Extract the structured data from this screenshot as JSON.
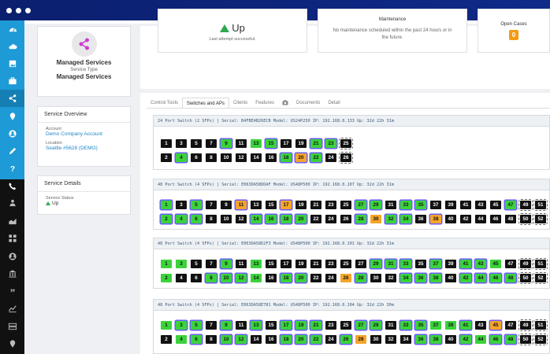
{
  "sidebar": {
    "items": [
      {
        "icon": "dashboard-icon",
        "active": false
      },
      {
        "icon": "cloud-icon",
        "active": false
      },
      {
        "icon": "image-icon",
        "active": false
      },
      {
        "icon": "briefcase-icon",
        "active": false
      },
      {
        "icon": "share-icon",
        "active": true
      },
      {
        "icon": "map-pin-icon",
        "active": false
      },
      {
        "icon": "user-circle-icon",
        "active": false
      },
      {
        "icon": "pencil-icon",
        "active": false
      },
      {
        "icon": "question-icon",
        "active": false
      },
      {
        "icon": "phone-icon",
        "active": false
      },
      {
        "icon": "users-icon",
        "active": false
      },
      {
        "icon": "area-chart-icon",
        "active": false
      },
      {
        "icon": "grid-icon",
        "active": false
      },
      {
        "icon": "dark-user-icon",
        "active": false
      },
      {
        "icon": "bank-icon",
        "active": false
      },
      {
        "icon": "quote-icon",
        "active": false
      },
      {
        "icon": "line-chart-icon",
        "active": false
      },
      {
        "icon": "server-icon",
        "active": false
      },
      {
        "icon": "location-icon",
        "active": false
      }
    ]
  },
  "service": {
    "name": "Managed Services",
    "type_label": "Service Type",
    "type": "Managed Services"
  },
  "overview": {
    "title": "Service Overview",
    "account_label": "Account",
    "account": "Demo Company Account",
    "location_label": "Location",
    "location": "Seattle #5628 (DEMO)"
  },
  "details": {
    "title": "Service Details",
    "status_label": "Service Status",
    "status": "Up"
  },
  "status": {
    "state": "Up",
    "sub": "Last attempt successful.",
    "maint_title": "Maintenance",
    "maint_text": "No maintenance scheduled within the past 24 hours or in the future.",
    "cases_title": "Open Cases",
    "cases_count": "0"
  },
  "tabs": [
    "Control Tools",
    "Switches and APs",
    "Clients",
    "Features",
    "",
    "Documents",
    "Detail"
  ],
  "active_tab": 1,
  "switches": [
    {
      "header": "24 Port Switch (2 SFPs) | Serial: B4FBE4B26ECB Model: US24P250 IP: 192.168.0.133 Up: 32d 22h 31m",
      "top": [
        {
          "n": "1",
          "c": "b"
        },
        {
          "n": "3",
          "c": "b"
        },
        {
          "n": "5",
          "c": "b"
        },
        {
          "n": "7",
          "c": "b"
        },
        {
          "n": "9",
          "c": "g",
          "r": 1
        },
        {
          "n": "11",
          "c": "b"
        },
        {
          "n": "13",
          "c": "g"
        },
        {
          "n": "15",
          "c": "g",
          "r": 1
        },
        {
          "n": "17",
          "c": "b"
        },
        {
          "n": "19",
          "c": "b"
        },
        {
          "n": "21",
          "c": "g",
          "r": 1
        },
        {
          "n": "23",
          "c": "g",
          "r": 1
        },
        {
          "n": "25",
          "c": "b",
          "s": 1
        }
      ],
      "bottom": [
        {
          "n": "2",
          "c": "b"
        },
        {
          "n": "4",
          "c": "g",
          "r": 1
        },
        {
          "n": "6",
          "c": "b"
        },
        {
          "n": "8",
          "c": "b"
        },
        {
          "n": "10",
          "c": "b"
        },
        {
          "n": "12",
          "c": "b"
        },
        {
          "n": "14",
          "c": "b"
        },
        {
          "n": "16",
          "c": "b"
        },
        {
          "n": "18",
          "c": "g",
          "r": 1
        },
        {
          "n": "20",
          "c": "o",
          "r": 1
        },
        {
          "n": "22",
          "c": "g",
          "r": 1
        },
        {
          "n": "24",
          "c": "b"
        },
        {
          "n": "26",
          "c": "b",
          "s": 1
        }
      ]
    },
    {
      "header": "48 Port Switch (4 SFPs) | Serial: E063DA58DDAF Model: US48P500 IP: 192.168.0.107 Up: 32d 22h 31m",
      "top": [
        {
          "n": "1",
          "c": "g",
          "r": 1
        },
        {
          "n": "3",
          "c": "b"
        },
        {
          "n": "5",
          "c": "g",
          "r": 1
        },
        {
          "n": "7",
          "c": "b"
        },
        {
          "n": "9",
          "c": "b"
        },
        {
          "n": "11",
          "c": "o",
          "r": 1
        },
        {
          "n": "13",
          "c": "b"
        },
        {
          "n": "15",
          "c": "b"
        },
        {
          "n": "17",
          "c": "o",
          "r": 1
        },
        {
          "n": "19",
          "c": "b"
        },
        {
          "n": "21",
          "c": "b"
        },
        {
          "n": "23",
          "c": "b"
        },
        {
          "n": "25",
          "c": "b"
        },
        {
          "n": "27",
          "c": "g",
          "r": 1
        },
        {
          "n": "29",
          "c": "g",
          "r": 1
        },
        {
          "n": "31",
          "c": "b"
        },
        {
          "n": "33",
          "c": "g",
          "r": 1
        },
        {
          "n": "35",
          "c": "g",
          "r": 1
        },
        {
          "n": "37",
          "c": "b"
        },
        {
          "n": "39",
          "c": "b"
        },
        {
          "n": "41",
          "c": "b"
        },
        {
          "n": "43",
          "c": "b"
        },
        {
          "n": "45",
          "c": "b"
        },
        {
          "n": "47",
          "c": "g",
          "r": 1
        },
        {
          "n": "49",
          "c": "b",
          "s": 1
        },
        {
          "n": "51",
          "c": "b",
          "s": 1
        }
      ],
      "bottom": [
        {
          "n": "2",
          "c": "g",
          "r": 1
        },
        {
          "n": "4",
          "c": "g",
          "r": 1
        },
        {
          "n": "6",
          "c": "g",
          "r": 1
        },
        {
          "n": "8",
          "c": "b"
        },
        {
          "n": "10",
          "c": "b"
        },
        {
          "n": "12",
          "c": "b"
        },
        {
          "n": "14",
          "c": "g",
          "r": 1
        },
        {
          "n": "16",
          "c": "g",
          "r": 1
        },
        {
          "n": "18",
          "c": "g",
          "r": 1
        },
        {
          "n": "20",
          "c": "g",
          "r": 1
        },
        {
          "n": "22",
          "c": "b"
        },
        {
          "n": "24",
          "c": "b"
        },
        {
          "n": "26",
          "c": "b"
        },
        {
          "n": "28",
          "c": "g",
          "r": 1
        },
        {
          "n": "30",
          "c": "o"
        },
        {
          "n": "32",
          "c": "g",
          "r": 1
        },
        {
          "n": "34",
          "c": "g",
          "r": 1
        },
        {
          "n": "36",
          "c": "b"
        },
        {
          "n": "38",
          "c": "o",
          "r": 1
        },
        {
          "n": "40",
          "c": "b"
        },
        {
          "n": "42",
          "c": "b"
        },
        {
          "n": "44",
          "c": "b"
        },
        {
          "n": "46",
          "c": "b"
        },
        {
          "n": "48",
          "c": "b"
        },
        {
          "n": "50",
          "c": "b",
          "s": 1
        },
        {
          "n": "52",
          "c": "b",
          "s": 1
        }
      ]
    },
    {
      "header": "48 Port Switch (4 SFPs) | Serial: E063DA58D2F3 Model: US48P500 IP: 192.168.0.101 Up: 32d 22h 31m",
      "top": [
        {
          "n": "1",
          "c": "g"
        },
        {
          "n": "3",
          "c": "g"
        },
        {
          "n": "5",
          "c": "b"
        },
        {
          "n": "7",
          "c": "b"
        },
        {
          "n": "9",
          "c": "g",
          "r": 1
        },
        {
          "n": "11",
          "c": "b"
        },
        {
          "n": "13",
          "c": "g"
        },
        {
          "n": "15",
          "c": "b"
        },
        {
          "n": "17",
          "c": "b"
        },
        {
          "n": "19",
          "c": "b"
        },
        {
          "n": "21",
          "c": "b"
        },
        {
          "n": "23",
          "c": "b"
        },
        {
          "n": "25",
          "c": "b"
        },
        {
          "n": "27",
          "c": "b"
        },
        {
          "n": "29",
          "c": "g",
          "r": 1
        },
        {
          "n": "31",
          "c": "g",
          "r": 1
        },
        {
          "n": "33",
          "c": "g",
          "r": 1
        },
        {
          "n": "35",
          "c": "b"
        },
        {
          "n": "37",
          "c": "g",
          "r": 1
        },
        {
          "n": "39",
          "c": "b"
        },
        {
          "n": "41",
          "c": "g",
          "r": 1
        },
        {
          "n": "43",
          "c": "g",
          "r": 1
        },
        {
          "n": "45",
          "c": "g"
        },
        {
          "n": "47",
          "c": "b"
        },
        {
          "n": "49",
          "c": "b",
          "s": 1
        },
        {
          "n": "51",
          "c": "b",
          "s": 1
        }
      ],
      "bottom": [
        {
          "n": "2",
          "c": "g"
        },
        {
          "n": "4",
          "c": "b"
        },
        {
          "n": "6",
          "c": "b"
        },
        {
          "n": "8",
          "c": "g",
          "r": 1
        },
        {
          "n": "10",
          "c": "g",
          "r": 1
        },
        {
          "n": "12",
          "c": "g",
          "r": 1
        },
        {
          "n": "14",
          "c": "g"
        },
        {
          "n": "16",
          "c": "b"
        },
        {
          "n": "18",
          "c": "g",
          "r": 1
        },
        {
          "n": "20",
          "c": "g",
          "r": 1
        },
        {
          "n": "22",
          "c": "b"
        },
        {
          "n": "24",
          "c": "b"
        },
        {
          "n": "26",
          "c": "o"
        },
        {
          "n": "28",
          "c": "g",
          "r": 1
        },
        {
          "n": "30",
          "c": "b"
        },
        {
          "n": "32",
          "c": "b"
        },
        {
          "n": "34",
          "c": "g",
          "r": 1
        },
        {
          "n": "36",
          "c": "g",
          "r": 1
        },
        {
          "n": "38",
          "c": "g",
          "r": 1
        },
        {
          "n": "40",
          "c": "b"
        },
        {
          "n": "42",
          "c": "g",
          "r": 1
        },
        {
          "n": "44",
          "c": "g",
          "r": 1
        },
        {
          "n": "46",
          "c": "g",
          "r": 1
        },
        {
          "n": "48",
          "c": "g",
          "r": 1
        },
        {
          "n": "50",
          "c": "b",
          "s": 1
        },
        {
          "n": "52",
          "c": "b",
          "s": 1
        }
      ]
    },
    {
      "header": "48 Port Switch (4 SFPs) | Serial: E063DA58E781 Model: US48P500 IP: 192.168.0.104 Up: 32d 22h 30m",
      "top": [
        {
          "n": "1",
          "c": "g"
        },
        {
          "n": "3",
          "c": "g",
          "r": 1
        },
        {
          "n": "5",
          "c": "g",
          "r": 1
        },
        {
          "n": "7",
          "c": "b"
        },
        {
          "n": "9",
          "c": "g",
          "r": 1
        },
        {
          "n": "11",
          "c": "b"
        },
        {
          "n": "13",
          "c": "g",
          "r": 1
        },
        {
          "n": "15",
          "c": "b"
        },
        {
          "n": "17",
          "c": "g",
          "r": 1
        },
        {
          "n": "19",
          "c": "g",
          "r": 1
        },
        {
          "n": "21",
          "c": "g",
          "r": 1
        },
        {
          "n": "23",
          "c": "b"
        },
        {
          "n": "25",
          "c": "b"
        },
        {
          "n": "27",
          "c": "g",
          "r": 1
        },
        {
          "n": "29",
          "c": "g",
          "r": 1
        },
        {
          "n": "31",
          "c": "b"
        },
        {
          "n": "33",
          "c": "g",
          "r": 1
        },
        {
          "n": "35",
          "c": "g",
          "r": 1
        },
        {
          "n": "37",
          "c": "g"
        },
        {
          "n": "39",
          "c": "g"
        },
        {
          "n": "41",
          "c": "g",
          "r": 1
        },
        {
          "n": "43",
          "c": "b"
        },
        {
          "n": "45",
          "c": "o",
          "r": 1
        },
        {
          "n": "47",
          "c": "b"
        },
        {
          "n": "49",
          "c": "b",
          "s": 1
        },
        {
          "n": "51",
          "c": "b",
          "s": 1
        }
      ],
      "bottom": [
        {
          "n": "2",
          "c": "b"
        },
        {
          "n": "4",
          "c": "g"
        },
        {
          "n": "6",
          "c": "g",
          "r": 1
        },
        {
          "n": "8",
          "c": "b"
        },
        {
          "n": "10",
          "c": "g",
          "r": 1
        },
        {
          "n": "12",
          "c": "g",
          "r": 1
        },
        {
          "n": "14",
          "c": "b"
        },
        {
          "n": "16",
          "c": "b"
        },
        {
          "n": "18",
          "c": "g",
          "r": 1
        },
        {
          "n": "20",
          "c": "g",
          "r": 1
        },
        {
          "n": "22",
          "c": "g",
          "r": 1
        },
        {
          "n": "24",
          "c": "b"
        },
        {
          "n": "26",
          "c": "g",
          "r": 1
        },
        {
          "n": "28",
          "c": "o"
        },
        {
          "n": "30",
          "c": "b"
        },
        {
          "n": "32",
          "c": "b"
        },
        {
          "n": "34",
          "c": "b"
        },
        {
          "n": "36",
          "c": "g",
          "r": 1
        },
        {
          "n": "38",
          "c": "g",
          "r": 1
        },
        {
          "n": "40",
          "c": "b"
        },
        {
          "n": "42",
          "c": "g",
          "r": 1
        },
        {
          "n": "44",
          "c": "g"
        },
        {
          "n": "46",
          "c": "g",
          "r": 1
        },
        {
          "n": "48",
          "c": "g",
          "r": 1
        },
        {
          "n": "50",
          "c": "b",
          "s": 1
        },
        {
          "n": "52",
          "c": "b",
          "s": 1
        }
      ]
    }
  ],
  "colors": {
    "brand_blue": "#1e9ad6",
    "topbar": "#0f2a88",
    "port_green": "#3bd23b",
    "port_orange": "#f4a52a",
    "port_idle": "#111111",
    "status_up": "#2da94f",
    "badge": "#f39c12"
  }
}
